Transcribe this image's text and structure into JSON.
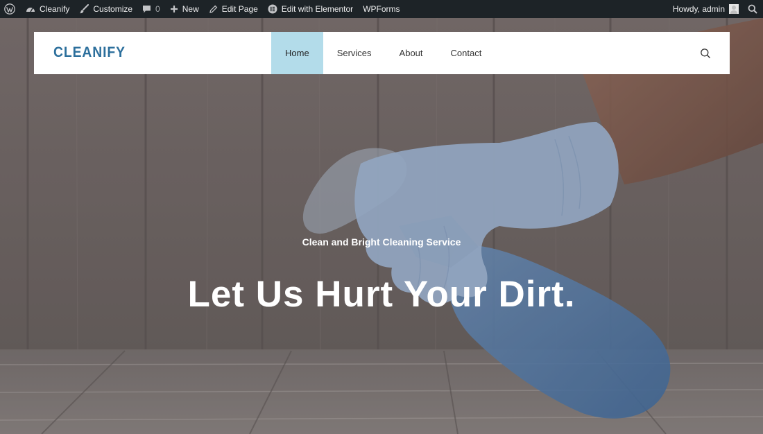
{
  "adminbar": {
    "site_name": "Cleanify",
    "customize": "Customize",
    "comments_count": "0",
    "new_label": "New",
    "edit_page": "Edit Page",
    "edit_elementor": "Edit with Elementor",
    "wpforms": "WPForms",
    "howdy": "Howdy, admin"
  },
  "header": {
    "logo": "CLEANIFY",
    "nav": [
      {
        "label": "Home",
        "active": true
      },
      {
        "label": "Services",
        "active": false
      },
      {
        "label": "About",
        "active": false
      },
      {
        "label": "Contact",
        "active": false
      }
    ],
    "search_icon": "search-icon"
  },
  "hero": {
    "subtitle": "Clean and Bright Cleaning Service",
    "title": "Let Us Hurt Your Dirt."
  },
  "colors": {
    "adminbar_bg": "#1d2327",
    "logo": "#2c6f9c",
    "nav_active_bg": "#b3dcea",
    "glove": "#9fb8d8",
    "bottle": "#4d7fb5"
  }
}
